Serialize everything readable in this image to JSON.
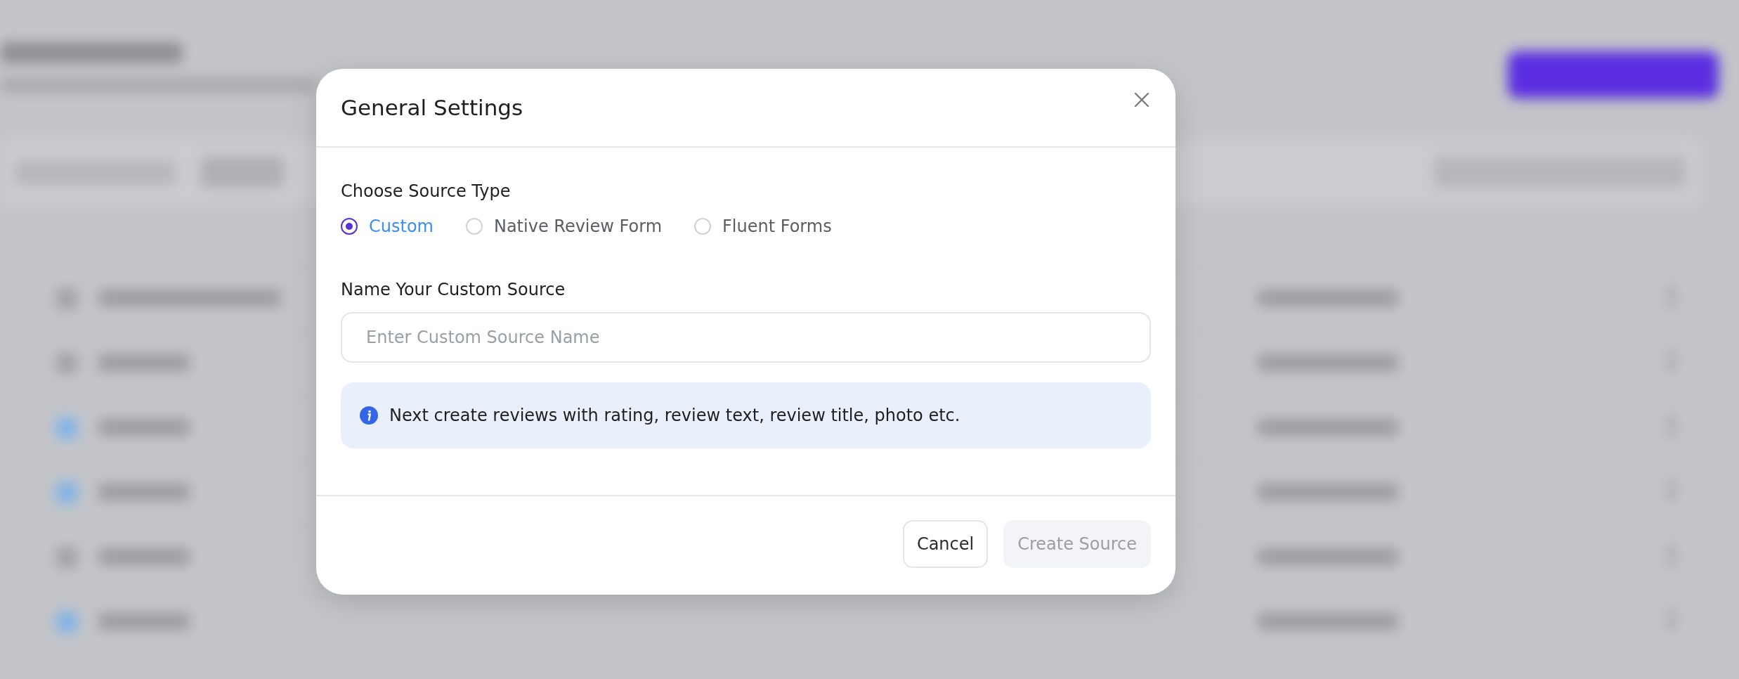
{
  "dialog": {
    "title": "General Settings",
    "source_type": {
      "label": "Choose Source Type",
      "options": [
        {
          "label": "Custom",
          "selected": true
        },
        {
          "label": "Native Review Form",
          "selected": false
        },
        {
          "label": "Fluent Forms",
          "selected": false
        }
      ]
    },
    "name_field": {
      "label": "Name Your Custom Source",
      "placeholder": "Enter Custom Source Name"
    },
    "info": "Next create reviews with rating, review text, review title, photo etc.",
    "buttons": [
      {
        "label": "Cancel",
        "disabled": false
      },
      {
        "label": "Create Source",
        "disabled": true
      }
    ]
  }
}
